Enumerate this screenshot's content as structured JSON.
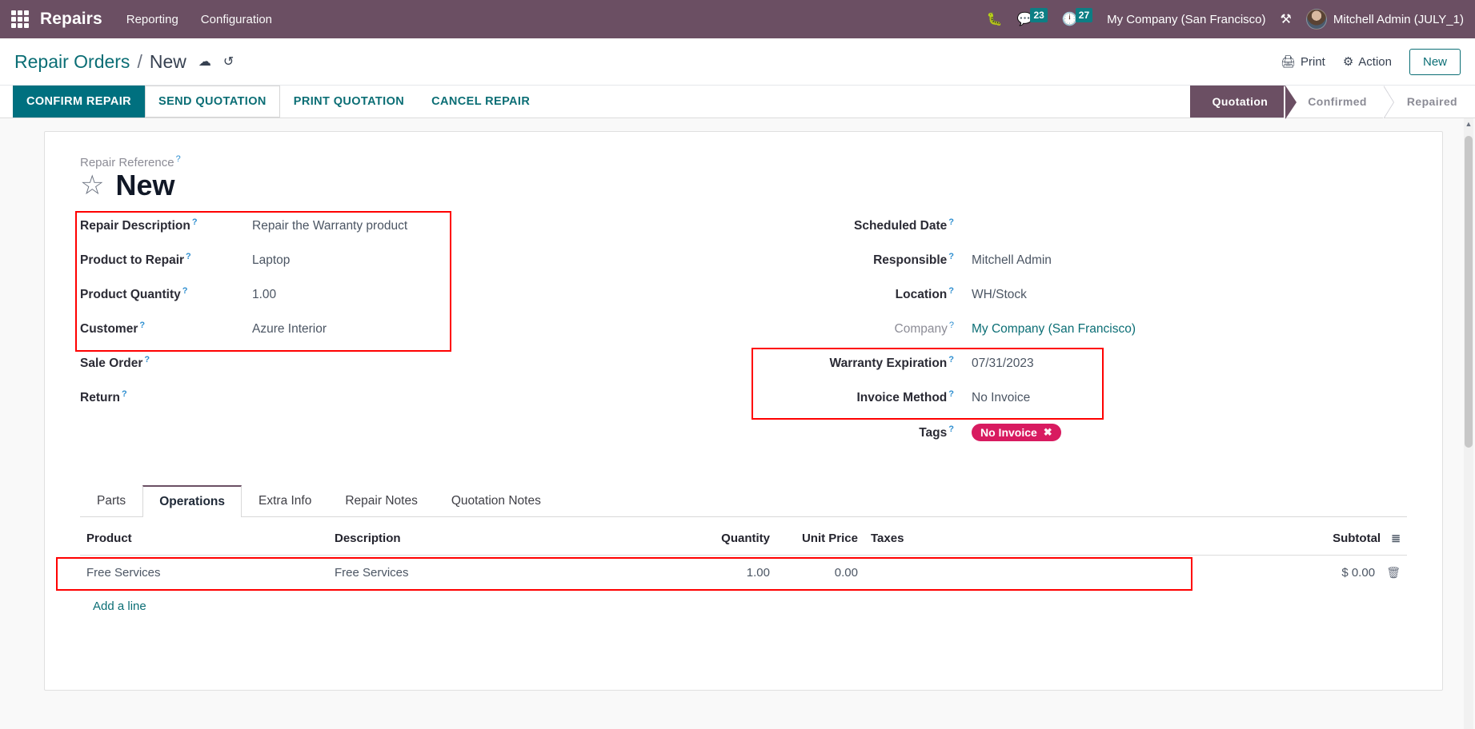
{
  "navbar": {
    "apps_icon": "apps-grid-icon",
    "brand": "Repairs",
    "menus": [
      {
        "label": "Reporting"
      },
      {
        "label": "Configuration"
      }
    ],
    "bug_icon": "bug-icon",
    "messages_icon": "chat-bubble-icon",
    "messages_count": "23",
    "activities_icon": "clock-icon",
    "activities_count": "27",
    "company": "My Company (San Francisco)",
    "tools_icon": "wrench-icon",
    "user": "Mitchell Admin (JULY_1)"
  },
  "control_panel": {
    "breadcrumb_root": "Repair Orders",
    "breadcrumb_sep": "/",
    "breadcrumb_current": "New",
    "save_icon": "cloud-upload-icon",
    "discard_icon": "undo-icon",
    "print_label": "Print",
    "print_icon": "printer-icon",
    "action_label": "Action",
    "action_icon": "gear-icon",
    "new_label": "New"
  },
  "buttons": [
    {
      "label": "Confirm Repair",
      "style": "primary"
    },
    {
      "label": "Send Quotation",
      "style": "secondary"
    },
    {
      "label": "Print Quotation",
      "style": "flat"
    },
    {
      "label": "Cancel Repair",
      "style": "flat"
    }
  ],
  "stages": [
    {
      "label": "Quotation",
      "active": true
    },
    {
      "label": "Confirmed",
      "active": false
    },
    {
      "label": "Repaired",
      "active": false
    }
  ],
  "form": {
    "reference_label": "Repair Reference",
    "title": "New",
    "star_icon": "star-outline-icon",
    "left_fields": [
      {
        "label": "Repair Description",
        "value": "Repair the Warranty  product",
        "muted": false,
        "link": false
      },
      {
        "label": "Product to Repair",
        "value": "Laptop",
        "muted": false,
        "link": false
      },
      {
        "label": "Product Quantity",
        "value": "1.00",
        "muted": false,
        "link": false
      },
      {
        "label": "Customer",
        "value": "Azure Interior",
        "muted": false,
        "link": false
      },
      {
        "label": "Sale Order",
        "value": "",
        "muted": false,
        "link": false
      },
      {
        "label": "Return",
        "value": "",
        "muted": false,
        "link": false
      }
    ],
    "right_fields": [
      {
        "label": "Scheduled Date",
        "value": "",
        "muted": false,
        "link": false
      },
      {
        "label": "Responsible",
        "value": "Mitchell Admin",
        "muted": false,
        "link": false
      },
      {
        "label": "Location",
        "value": "WH/Stock",
        "muted": false,
        "link": false
      },
      {
        "label": "Company",
        "value": "My Company (San Francisco)",
        "muted": true,
        "link": true
      },
      {
        "label": "Warranty Expiration",
        "value": "07/31/2023",
        "muted": false,
        "link": false
      },
      {
        "label": "Invoice Method",
        "value": "No Invoice",
        "muted": false,
        "link": false
      }
    ],
    "tags_label": "Tags",
    "tag": {
      "label": "No Invoice",
      "color": "#d81b60",
      "remove_icon": "close-icon"
    }
  },
  "notebook": {
    "tabs": [
      {
        "label": "Parts",
        "active": false
      },
      {
        "label": "Operations",
        "active": true
      },
      {
        "label": "Extra Info",
        "active": false
      },
      {
        "label": "Repair Notes",
        "active": false
      },
      {
        "label": "Quotation Notes",
        "active": false
      }
    ],
    "columns": [
      "Product",
      "Description",
      "Quantity",
      "Unit Price",
      "Taxes",
      "Subtotal"
    ],
    "optional_columns_icon": "column-settings-icon",
    "rows": [
      {
        "product": "Free Services",
        "description": "Free Services",
        "quantity": "1.00",
        "unit_price": "0.00",
        "taxes": "",
        "subtotal": "$ 0.00",
        "delete_icon": "trash-icon"
      }
    ],
    "add_line_label": "Add a line"
  },
  "annotations": {
    "box_color": "#ff0000",
    "boxes": [
      "left-fields-highlight",
      "warranty-invoice-highlight",
      "operations-row-highlight"
    ]
  }
}
